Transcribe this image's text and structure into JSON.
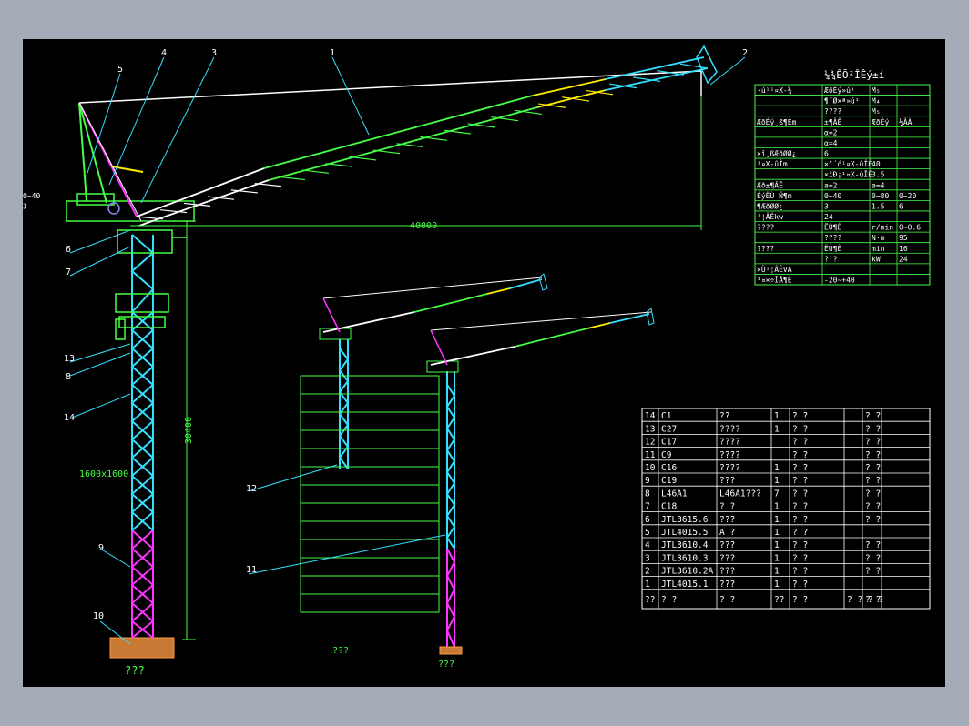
{
  "callouts": [
    "1",
    "2",
    "3",
    "4",
    "5",
    "6",
    "7",
    "8",
    "9",
    "10",
    "11",
    "12",
    "13",
    "14"
  ],
  "dims": {
    "jib_length": "40000",
    "height": "30400",
    "section": "1600x1600"
  },
  "foundation_labels": [
    "???",
    "???",
    "???"
  ],
  "spec_table": {
    "title": "¼¾ÊÕ²ÎÊý±í",
    "rows": [
      [
        "·ú¹¹¤X-¼",
        "ÆðÉý»ú¹",
        "M₅"
      ],
      [
        "",
        "¶¯Ø×ª»ú¹",
        "M₄"
      ],
      [
        "",
        "????",
        "M₅"
      ],
      [
        "ÆðÉý¸ß¶Èm",
        "±¶ÂÊ",
        "ÆðÉý",
        "½ÂÀ"
      ],
      [
        "",
        "α=2",
        "",
        ""
      ],
      [
        "",
        "α=4",
        "",
        ""
      ],
      [
        "×î¸ßÆðØØ¿",
        "6",
        "",
        ""
      ],
      [
        "¹¤X-ûÎm",
        "×î´ó¹¤X-ûÎÉ",
        "40",
        ""
      ],
      [
        "",
        "×îÐ¡¹¤X-ûÎÉ",
        "3.5",
        ""
      ],
      [
        "Æð±¶ÂÊ",
        "a=2",
        "a=4",
        ""
      ],
      [
        "ÉýËÙ Ñ¶m",
        "0~40",
        "0~80",
        "0~20",
        "0~40"
      ],
      [
        "¶ÆðØØ¿",
        "3",
        "1.5",
        "6",
        "3"
      ],
      [
        "¹¦ÂÊkw",
        "24",
        "",
        ""
      ],
      [
        "????",
        "ËÙ¶È",
        "r/min",
        "0~0.6"
      ],
      [
        "",
        "????",
        "N·m",
        "95"
      ],
      [
        "????",
        "ËÙ¶È",
        "min",
        "16"
      ],
      [
        "",
        "? ?",
        "kW",
        "24"
      ],
      [
        "×Ü¹¦ÂÊVA",
        "",
        "",
        ""
      ],
      [
        "¹¤×÷ÎÂ¶È",
        "-20~+40",
        "",
        ""
      ]
    ]
  },
  "parts_table": {
    "rows": [
      [
        "14",
        "C1",
        "??",
        "1",
        "? ?",
        "",
        "? ?"
      ],
      [
        "13",
        "C27",
        "????",
        "1",
        "? ?",
        "",
        "? ?"
      ],
      [
        "12",
        "C17",
        "????",
        "",
        "? ?",
        "",
        "? ?"
      ],
      [
        "11",
        "C9",
        "????",
        "",
        "? ?",
        "",
        "? ?"
      ],
      [
        "10",
        "C16",
        "????",
        "1",
        "? ?",
        "",
        "? ?"
      ],
      [
        "9",
        "C19",
        "???",
        "1",
        "? ?",
        "",
        "? ?"
      ],
      [
        "8",
        "L46A1",
        "L46A1???",
        "7",
        "? ?",
        "",
        "? ?"
      ],
      [
        "7",
        "C18",
        "? ?",
        "1",
        "? ?",
        "",
        "? ?"
      ],
      [
        "6",
        "JTL3615.6",
        "???",
        "1",
        "? ?",
        "",
        "? ?"
      ],
      [
        "5",
        "JTL4015.5",
        "A ?",
        "1",
        "? ?",
        "",
        ""
      ],
      [
        "4",
        "JTL3610.4",
        "???",
        "1",
        "? ?",
        "",
        "? ?"
      ],
      [
        "3",
        "JTL3610.3",
        "???",
        "1",
        "? ?",
        "",
        "? ?"
      ],
      [
        "2",
        "JTL3610.2A",
        "???",
        "1",
        "? ?",
        "",
        "? ?"
      ],
      [
        "1",
        "JTL4015.1",
        "???",
        "1",
        "? ?",
        "",
        ""
      ]
    ],
    "header": [
      "??",
      "? ?",
      "? ?",
      "??",
      "? ?",
      "? ? ? ?",
      "? ?"
    ]
  }
}
